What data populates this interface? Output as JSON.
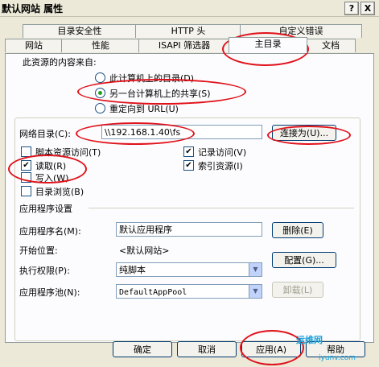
{
  "window": {
    "title": "默认网站 属性",
    "help_btn": "?",
    "close_btn": "X"
  },
  "tabs": {
    "row1": [
      "目录安全性",
      "HTTP 头",
      "自定义错误"
    ],
    "row2": [
      "网站",
      "性能",
      "ISAPI 筛选器",
      "主目录",
      "文档"
    ]
  },
  "content_source": {
    "heading": "此资源的内容来自:",
    "options": [
      "此计算机上的目录(D)",
      "另一台计算机上的共享(S)",
      "重定向到 URL(U)"
    ]
  },
  "network_dir": {
    "label": "网络目录(C):",
    "value": "\\\\192.168.1.40\\fs",
    "connect_btn": "连接为(U)..."
  },
  "permissions": {
    "left": [
      "脚本资源访问(T)",
      "读取(R)",
      "写入(W)",
      "目录浏览(B)"
    ],
    "right": [
      "记录访问(V)",
      "索引资源(I)"
    ]
  },
  "app_settings": {
    "heading": "应用程序设置",
    "app_name_label": "应用程序名(M):",
    "app_name_value": "默认应用程序",
    "remove_btn": "删除(E)",
    "start_label": "开始位置:",
    "start_value": "<默认网站>",
    "config_btn": "配置(G)...",
    "exec_label": "执行权限(P):",
    "exec_value": "纯脚本",
    "pool_label": "应用程序池(N):",
    "pool_value": "DefaultAppPool",
    "unload_btn": "卸载(L)"
  },
  "footer": {
    "ok": "确定",
    "cancel": "取消",
    "apply": "应用(A)",
    "help": "帮助"
  },
  "watermark": {
    "text1": "运维网",
    "text2": "iyunv.com"
  }
}
